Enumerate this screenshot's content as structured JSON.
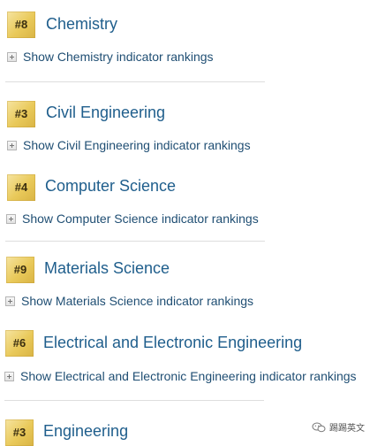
{
  "rankings": [
    {
      "rank": "#8",
      "subject": "Chemistry",
      "toggle": "Show Chemistry indicator rankings"
    },
    {
      "rank": "#3",
      "subject": "Civil Engineering",
      "toggle": "Show Civil Engineering indicator rankings"
    },
    {
      "rank": "#4",
      "subject": "Computer Science",
      "toggle": "Show Computer Science indicator rankings"
    },
    {
      "rank": "#9",
      "subject": "Materials Science",
      "toggle": "Show Materials Science indicator rankings"
    },
    {
      "rank": "#6",
      "subject": "Electrical and Electronic Engineering",
      "toggle": "Show Electrical and Electronic Engineering indicator rankings"
    },
    {
      "rank": "#3",
      "subject": "Engineering"
    }
  ],
  "watermark": {
    "text": "踢踢英文",
    "icon": "wechat-icon"
  }
}
